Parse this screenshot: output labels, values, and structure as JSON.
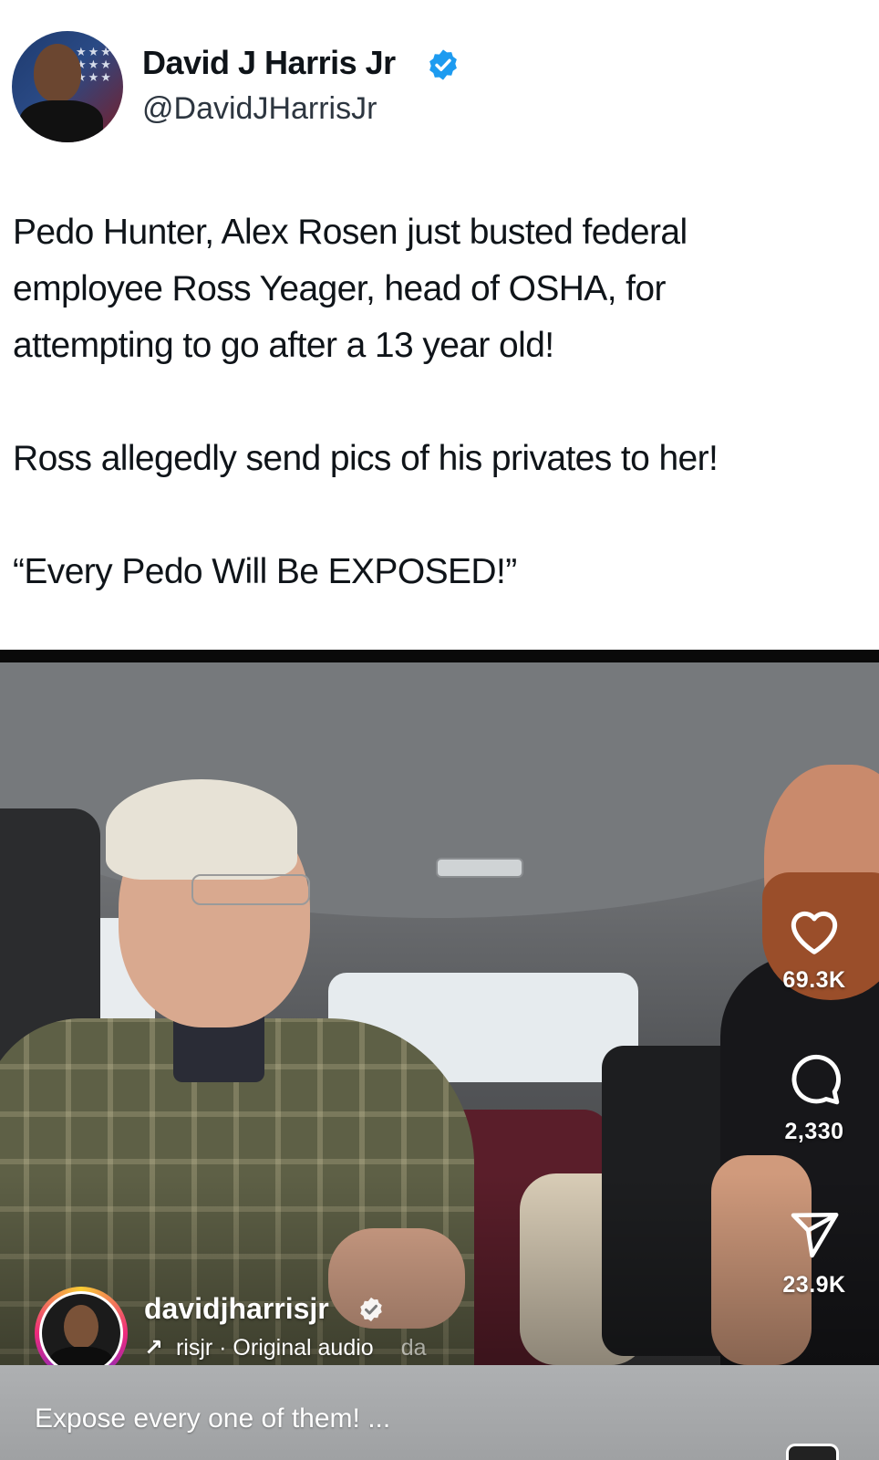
{
  "tweet": {
    "author_name": "David J Harris Jr",
    "author_handle": "@DavidJHarrisJr",
    "lines": [
      "Pedo Hunter, Alex Rosen just busted federal",
      "employee Ross Yeager, head of OSHA, for",
      "attempting to go after a 13 year old!",
      "",
      "Ross allegedly send pics of his privates to her!",
      "",
      "“Every Pedo Will Be EXPOSED!”"
    ]
  },
  "reel": {
    "likes": "69.3K",
    "comments": "2,330",
    "shares": "23.9K",
    "username": "davidjharrisjr",
    "audio_text": "risjr · Original audio",
    "audio_overflow": "da",
    "caption": "Expose every one of them! ...",
    "more_label": "..."
  },
  "colors": {
    "verified_blue": "#1d9bf0",
    "caption_bar": "#a7a9ab"
  },
  "icons": [
    "verified-icon",
    "heart-icon",
    "comment-icon",
    "share-icon",
    "more-icon",
    "arrow-icon"
  ]
}
